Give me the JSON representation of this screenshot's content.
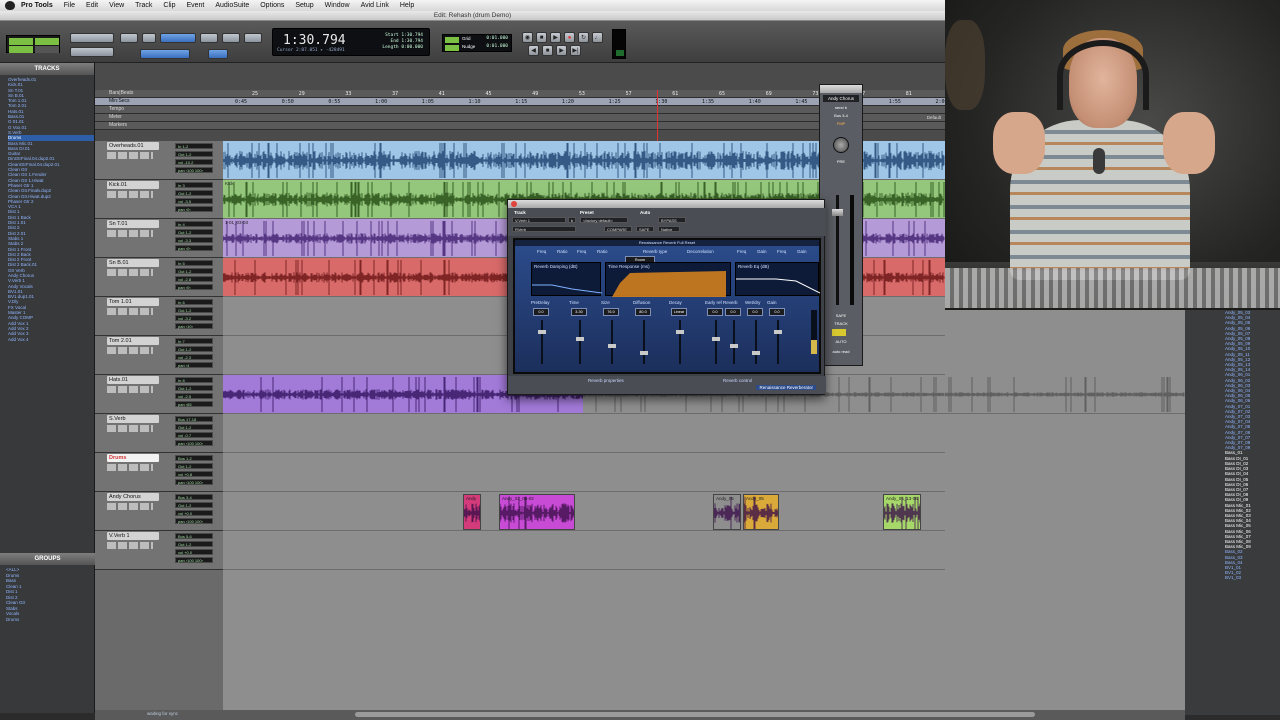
{
  "menubar": {
    "app": "Pro Tools",
    "items": [
      "File",
      "Edit",
      "View",
      "Track",
      "Clip",
      "Event",
      "AudioSuite",
      "Options",
      "Setup",
      "Window",
      "Avid Link",
      "Help"
    ]
  },
  "window_title": "Edit: Rehash (drum Demo)",
  "toolbar": {
    "counter_main": "1:30.794",
    "counter_side": [
      "Start 1:30.794",
      "End 1:30.794",
      "Length 0:00.000"
    ],
    "counter_sub": "Cursor  2:07.051  ▸ -428491",
    "counter2_labels": [
      "Grid",
      "Nudge"
    ],
    "counter2_values": [
      "0:01.000",
      "0:01.000"
    ]
  },
  "rulers": {
    "rows": [
      "Bars|Beats",
      "Min:Secs",
      "Tempo",
      "Meter",
      "Markers"
    ],
    "bar_numbers": [
      "25",
      "29",
      "33",
      "37",
      "41",
      "45",
      "49",
      "53",
      "57",
      "61",
      "65",
      "69",
      "73",
      "77",
      "81"
    ],
    "min_secs": [
      "0:45",
      "0:50",
      "0:55",
      "1:00",
      "1:05",
      "1:10",
      "1:15",
      "1:20",
      "1:25",
      "1:30",
      "1:35",
      "1:40",
      "1:45",
      "1:50",
      "1:55",
      "2:00"
    ],
    "right_marker": "Default"
  },
  "sidebar": {
    "header": "TRACKS",
    "tracks": [
      "Overheads.01",
      "Kick.01",
      "Sn T.01",
      "Sn B.01",
      "Tom 1.01",
      "Tom 2.01",
      "Hats.01",
      "Bass.01",
      "G 01.01",
      "G Vox.01",
      "S.Verb",
      "Drums",
      "Bass Mic.01",
      "Bass DI.01",
      "Guitar",
      "DinGtrFinal.04.dup2.01",
      "CleanGtrFinal.04.dup2.01",
      "Clean Gtr",
      "Clean Gtr 1.Fender",
      "Clean Gtr 1.Hiwat",
      "Phaser Gtr 1",
      "Clean Gtr.Finalv.dup2",
      "Clean Gtr.Hiwat.dup2",
      "Phaser Gtr 2",
      "VCA 1",
      "Dist 1",
      "Dist 1 Back",
      "Dist 1.01",
      "Dist 2",
      "Dist 2.01",
      "Stabs 1",
      "Stabs 2",
      "Dist 1 Front",
      "Dist 2 Back",
      "Dist 2 Front",
      "Dist 2 Back.01",
      "Gtr Verb",
      "Andy Chorus",
      "V.Verb 1",
      "Andy Vocals",
      "BV1.01",
      "BV1.dup1.01",
      "V.Dly",
      "FX Vocal",
      "Master 1",
      "Andy COMP",
      "Add Vox 1",
      "Add Vox 2",
      "Add Vox 3",
      "Add Vox 4"
    ],
    "selected_index": 11,
    "groups_header": "GROUPS",
    "groups": [
      "<ALL>",
      "Drums",
      "Bass",
      "Clean 1",
      "Dist 1",
      "Dist 2",
      "Clean Gtr",
      "Stabs",
      "Vocals",
      "Drums"
    ]
  },
  "tracks": [
    {
      "name": "Overheads.01",
      "io": [
        "In 1-2",
        "Out 1-2",
        "vol  -10.2",
        "pan  ›100 100‹"
      ],
      "color": "#9fc6e6"
    },
    {
      "name": "Kick.01",
      "io": [
        "In 3",
        "Out 1-2",
        "vol  -3.5",
        "pan  ›0‹"
      ],
      "color": "#94c77c"
    },
    {
      "name": "Sn T.01",
      "io": [
        "In 4",
        "Out 1-2",
        "vol  -3.3",
        "pan  ›0‹"
      ],
      "color": "#b59ad8"
    },
    {
      "name": "Sn B.01",
      "io": [
        "In 5",
        "Out 1-2",
        "vol  -2.8",
        "pan  ›0‹"
      ],
      "color": "#d86a6a"
    },
    {
      "name": "Tom 1.01",
      "io": [
        "In 6",
        "Out 1-2",
        "vol  -3.2",
        "pan  ›10‹"
      ],
      "color": "#8e8e8e"
    },
    {
      "name": "Tom 2.01",
      "io": [
        "In 7",
        "Out 1-2",
        "vol  -2.3",
        "pan  ‹4"
      ],
      "color": "#8e8e8e"
    },
    {
      "name": "Hats.01",
      "io": [
        "In 8",
        "Out 1-2",
        "vol  -2.5",
        "pan  ›65"
      ],
      "color": "#a27ad8"
    },
    {
      "name": "S.Verb",
      "io": [
        "Bus 17-18",
        "Out 1-2",
        "vol  -0.7",
        "pan  ›100 100‹"
      ],
      "color": "#8e8e8e"
    },
    {
      "name": "Drums",
      "io": [
        "Bus 1-2",
        "Out 1-2",
        "vol  +0.8",
        "pan  ›100 100‹"
      ],
      "color": "#8e8e8e"
    },
    {
      "name": "Andy Chorus",
      "io": [
        "Bus 3-4",
        "Out 1-2",
        "vol  +0.0",
        "pan  ›100 100‹"
      ],
      "color": "#8e8e8e"
    },
    {
      "name": "V.Verb 1",
      "io": [
        "Bus 5-6",
        "Out 1-2",
        "vol  +0.0",
        "pan  ›100 100‹"
      ],
      "color": "#8e8e8e"
    }
  ],
  "clips": {
    "kick_label": "Kick",
    "sn_label": "1-01_03-03",
    "bottom": [
      "Andy",
      "Andy_02_06-02",
      "Andy_05",
      "Andy_05",
      "Andy_05_13-06",
      "Andy_05_12"
    ]
  },
  "plugin": {
    "track_label": "Track",
    "preset_label": "Preset",
    "auto_label": "Auto",
    "track_name": "V.Verb 1",
    "insert": "b",
    "insert_name": "RVerb",
    "preset_name": "<factory default>",
    "bypass": "BYPASS",
    "compare": "COMPARE",
    "safe": "SAFE",
    "native": "Native",
    "title": "Renaissance Reverb Full Reset",
    "controls": [
      "Freq",
      "Ratio",
      "Freq",
      "Ratio",
      "Reverb type",
      "Decorrelation",
      "Freq",
      "Gain",
      "Freq",
      "Gain"
    ],
    "type_value": "Room",
    "displays": [
      "Reverb Damping (dB)",
      "Time Response (ms)",
      "Reverb Eq (dB)"
    ],
    "sliders": [
      "PreDelay",
      "Time",
      "Size",
      "Diffusion",
      "Decay",
      "Early ref",
      "Reverb",
      "Wet/dry",
      "Gain"
    ],
    "slider_values": [
      "0.0",
      "3.30",
      "76.0",
      "80.0",
      "Linear",
      "0.0",
      "0.0",
      "0.0",
      "0.0"
    ],
    "footer_left": "Reverb properties",
    "footer_right": "Reverb control",
    "brand": "Renaissance Reverberator"
  },
  "send": {
    "name": "Andy Chorus",
    "bus": "Bus 3-4",
    "slot": "send b",
    "pre": "PRE",
    "fmp": "FMP",
    "safe": "SAFE",
    "track": "TRACK",
    "auto": "AUTO",
    "mode": "auto read"
  },
  "clip_list": [
    "Andy_05_03",
    "Andy_05_04",
    "Andy_05_05",
    "Andy_05_06",
    "Andy_05_07",
    "Andy_05_08",
    "Andy_05_09",
    "Andy_05_10",
    "Andy_05_11",
    "Andy_05_12",
    "Andy_05_13",
    "Andy_05_14",
    "Andy_06_01",
    "Andy_06_02",
    "Andy_06_03",
    "Andy_06_04",
    "Andy_06_05",
    "Andy_06_06",
    "Andy_07_01",
    "Andy_07_02",
    "Andy_07_03",
    "Andy_07_04",
    "Andy_07_05",
    "Andy_07_06",
    "Andy_07_07",
    "Andy_07_08",
    "Andy_07_09",
    "Bass_01",
    "Bass DI_01",
    "Bass DI_02",
    "Bass DI_03",
    "Bass DI_04",
    "Bass DI_05",
    "Bass DI_06",
    "Bass DI_07",
    "Bass DI_08",
    "Bass DI_09",
    "Bass Mic_01",
    "Bass Mic_02",
    "Bass Mic_03",
    "Bass Mic_04",
    "Bass Mic_05",
    "Bass Mic_06",
    "Bass Mic_07",
    "Bass Mic_08",
    "Bass Mic_09",
    "Bass_02",
    "Bass_03",
    "Bass_04",
    "BV1_01",
    "BV1_02",
    "BV1_03"
  ],
  "bottom_status": "waiting for sync"
}
